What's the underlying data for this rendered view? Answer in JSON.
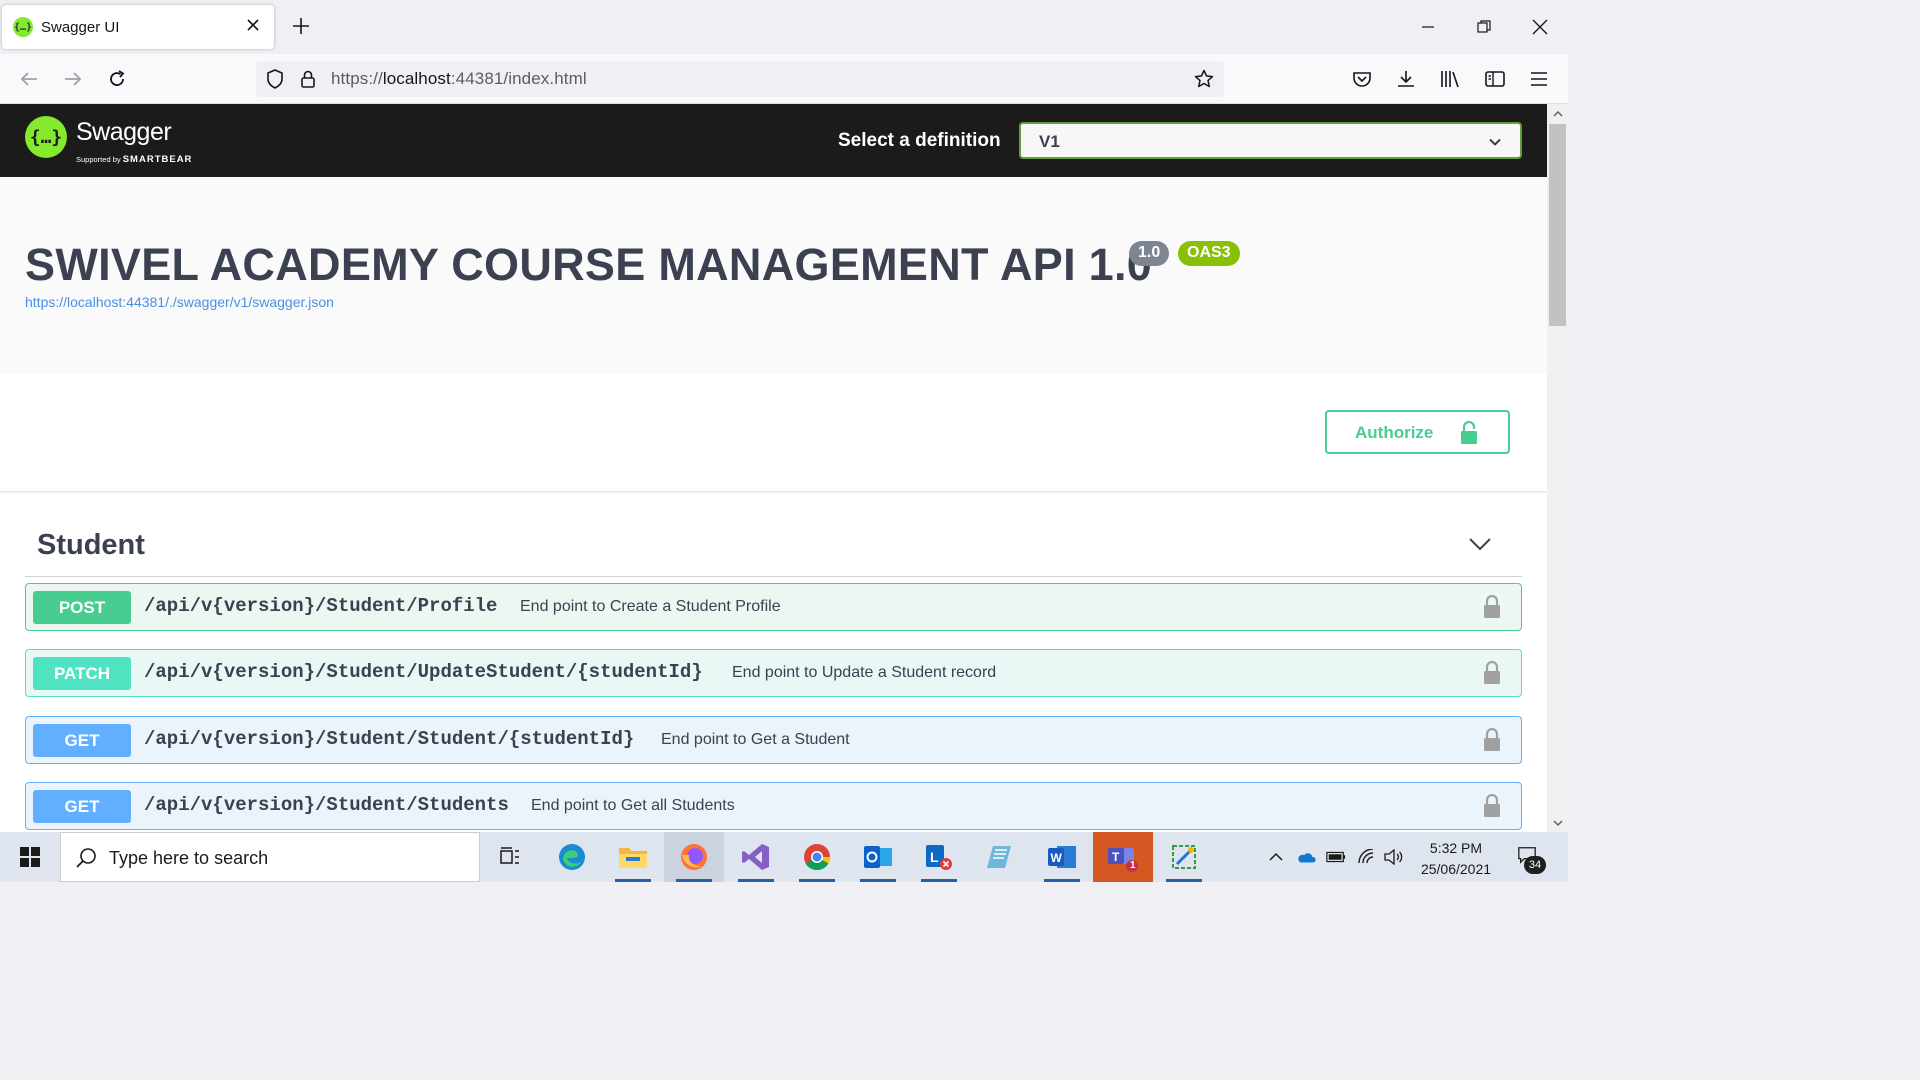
{
  "browser": {
    "tab_title": "Swagger UI",
    "url_scheme": "https://",
    "url_host": "localhost",
    "url_rest": ":44381/index.html"
  },
  "swagger": {
    "brand": "Swagger",
    "supported_by": "Supported by",
    "smartbear": "SMARTBEAR",
    "select_definition_label": "Select a definition",
    "definition_value": "V1",
    "colors": {
      "topbar": "#1b1b1b",
      "brand_green": "#85ea2d",
      "post": "#49cc90",
      "patch": "#50e3c2",
      "get": "#61affe"
    }
  },
  "info": {
    "title": "SWIVEL ACADEMY COURSE MANAGEMENT API 1.0",
    "version_badge": "1.0",
    "oas_badge": "OAS3",
    "spec_url": "https://localhost:44381/./swagger/v1/swagger.json"
  },
  "auth": {
    "button_label": "Authorize"
  },
  "tag": {
    "name": "Student",
    "operations": [
      {
        "method": "POST",
        "path": "/api/v{version}/Student/Profile",
        "description": "End point to Create a Student Profile"
      },
      {
        "method": "PATCH",
        "path": "/api/v{version}/Student/UpdateStudent/{studentId}",
        "description": "End point to Update a Student record"
      },
      {
        "method": "GET",
        "path": "/api/v{version}/Student/Student/{studentId}",
        "description": "End point to Get a Student"
      },
      {
        "method": "GET",
        "path": "/api/v{version}/Student/Students",
        "description": "End point to Get all Students"
      }
    ]
  },
  "taskbar": {
    "search_placeholder": "Type here to search",
    "time": "5:32 PM",
    "date": "25/06/2021",
    "notification_count": "34",
    "teams_badge": "1"
  }
}
